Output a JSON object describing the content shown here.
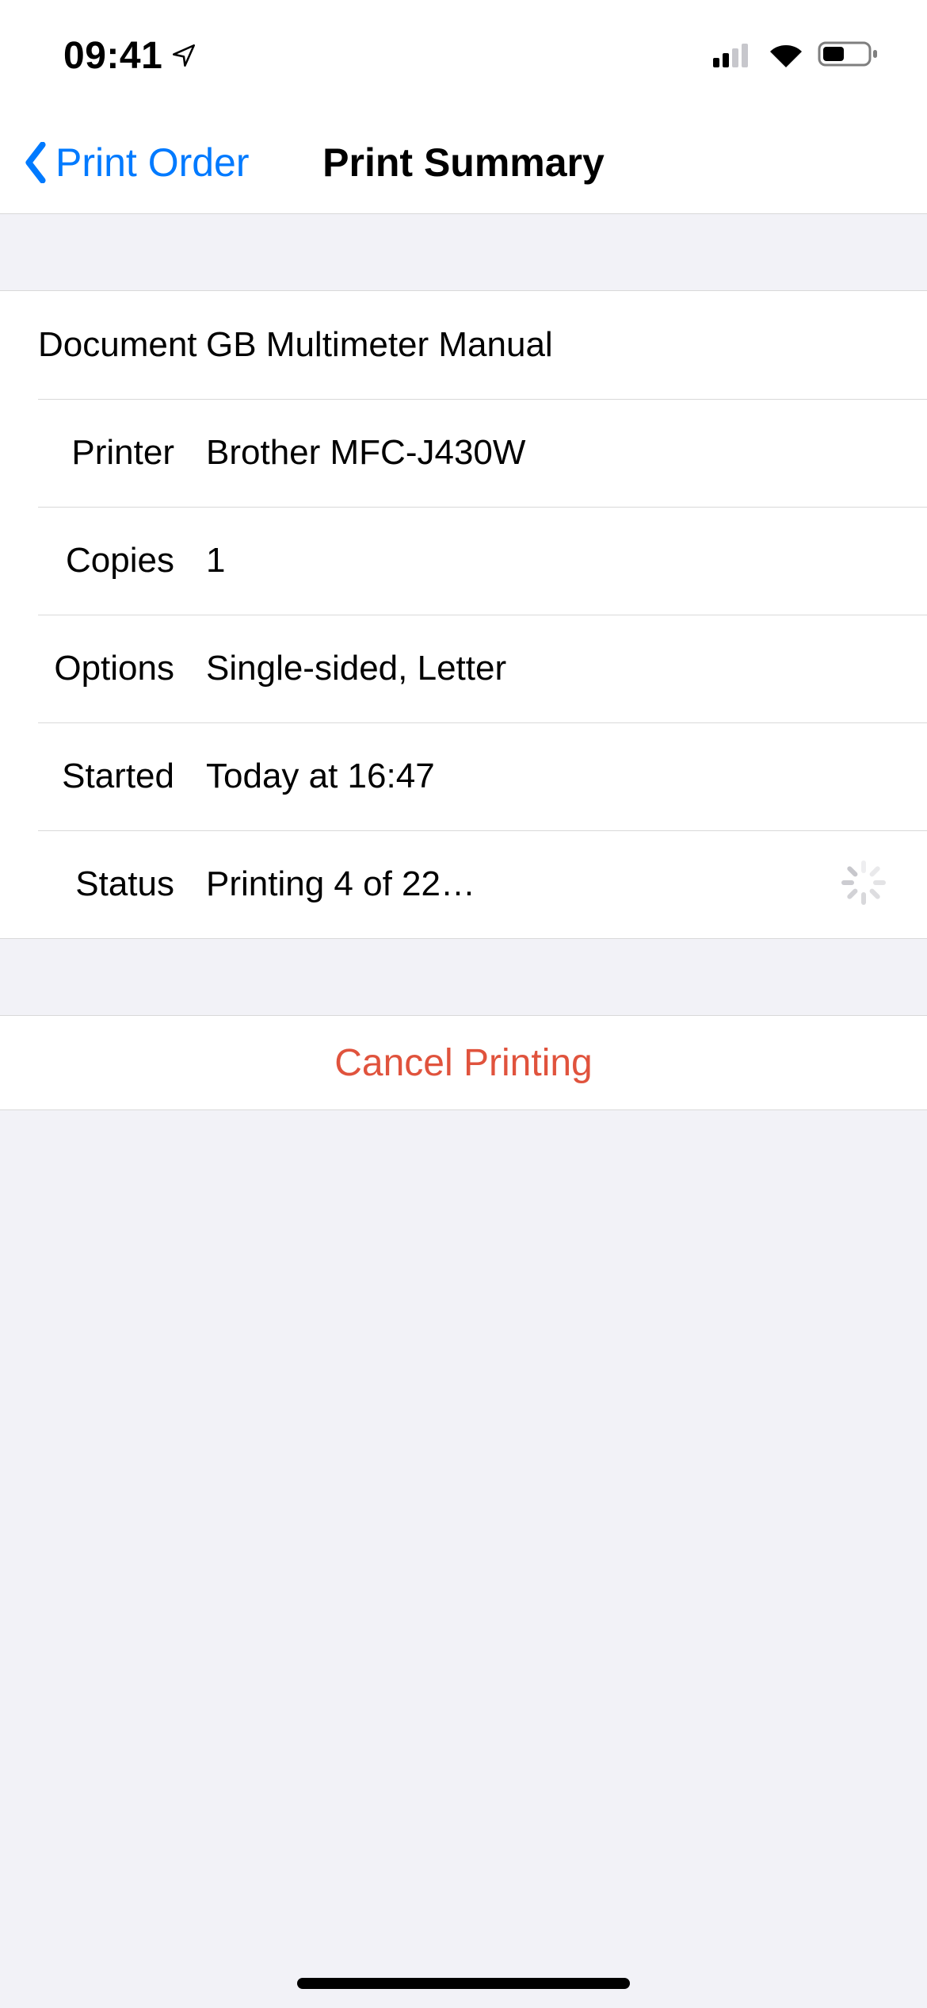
{
  "status_bar": {
    "time": "09:41"
  },
  "nav": {
    "back_label": "Print Order",
    "title": "Print Summary"
  },
  "rows": {
    "document": {
      "label": "Document",
      "value": "GB Multimeter Manual"
    },
    "printer": {
      "label": "Printer",
      "value": "Brother MFC-J430W"
    },
    "copies": {
      "label": "Copies",
      "value": "1"
    },
    "options": {
      "label": "Options",
      "value": "Single-sided, Letter"
    },
    "started": {
      "label": "Started",
      "value": "Today at 16:47"
    },
    "status": {
      "label": "Status",
      "value": "Printing 4 of 22…"
    }
  },
  "action": {
    "cancel_label": "Cancel Printing"
  }
}
